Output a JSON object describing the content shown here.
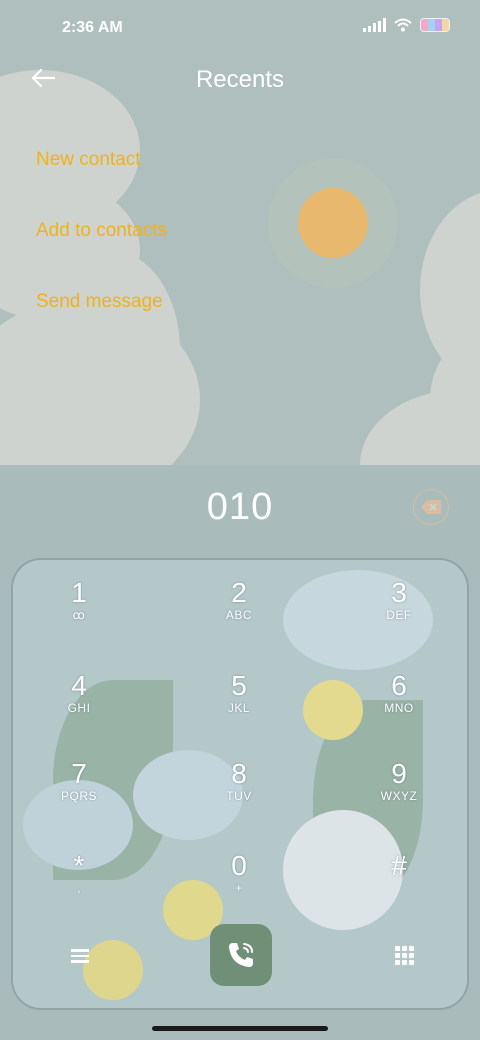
{
  "status_bar": {
    "time": "2:36 AM",
    "icons": [
      "signal-icon",
      "wifi-icon",
      "battery-icon"
    ]
  },
  "header": {
    "title": "Recents",
    "back_icon": "arrow-left-icon"
  },
  "actions": [
    {
      "label": "New contact"
    },
    {
      "label": "Add to contacts"
    },
    {
      "label": "Send message"
    }
  ],
  "dialer": {
    "number": "010",
    "backspace_icon": "backspace-icon"
  },
  "keypad": {
    "keys": [
      {
        "digit": "1",
        "letters": "ꝏ"
      },
      {
        "digit": "2",
        "letters": "ABC"
      },
      {
        "digit": "3",
        "letters": "DEF"
      },
      {
        "digit": "4",
        "letters": "GHI"
      },
      {
        "digit": "5",
        "letters": "JKL"
      },
      {
        "digit": "6",
        "letters": "MNO"
      },
      {
        "digit": "7",
        "letters": "PQRS"
      },
      {
        "digit": "8",
        "letters": "TUV"
      },
      {
        "digit": "9",
        "letters": "WXYZ"
      },
      {
        "digit": "*",
        "letters": ","
      },
      {
        "digit": "0",
        "letters": "+"
      },
      {
        "digit": "#",
        "letters": ""
      }
    ],
    "bottom": {
      "menu_icon": "menu-icon",
      "call_icon": "phone-call-icon",
      "dialpad_icon": "dialpad-icon"
    }
  },
  "colors": {
    "accent_link": "#f0b21c",
    "call_button": "#6f8f77",
    "background": "#aebfbe"
  }
}
